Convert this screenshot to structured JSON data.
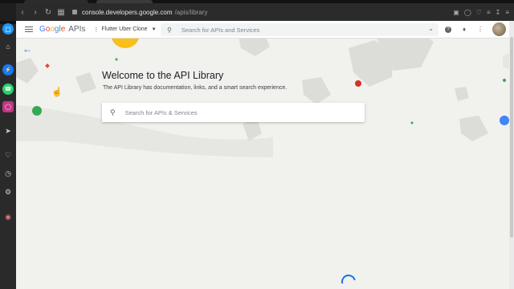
{
  "browser": {
    "url_host": "console.developers.google.com",
    "url_path": "/apis/library"
  },
  "header": {
    "logo_google": [
      "G",
      "o",
      "o",
      "g",
      "l",
      "e"
    ],
    "logo_product": "APIs",
    "project_name": "Flutter Uber Clone",
    "search_placeholder": "Search for APIs and Services"
  },
  "hero": {
    "title": "Welcome to the API Library",
    "subtitle": "The API Library has documentation, links, and a smart search experience.",
    "search_placeholder": "Search for APIs & Services"
  },
  "icons": {
    "menu": "hamburger-icon",
    "search": "search-icon",
    "help": "help-icon",
    "notifications": "bell-icon",
    "more": "more-vert-icon",
    "back": "arrow-back-icon"
  },
  "colors": {
    "accent": "#1a73e8",
    "google_blue": "#4285f4",
    "google_red": "#ea4335",
    "google_yellow": "#fbbc05",
    "google_green": "#34a853"
  }
}
